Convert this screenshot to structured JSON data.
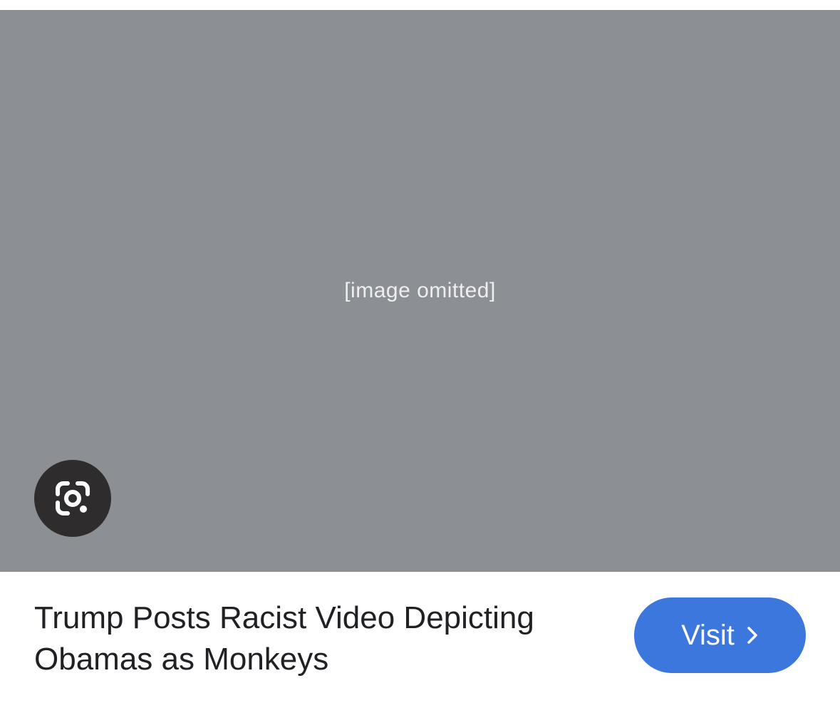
{
  "image": {
    "placeholder_text": "[image omitted]"
  },
  "lens": {
    "icon": "google-lens-icon"
  },
  "result": {
    "title": "Trump Posts Racist Video Depicting Obamas as Monkeys"
  },
  "visit": {
    "label": "Visit",
    "icon": "chevron-right-icon",
    "color": "#3b77dd"
  }
}
